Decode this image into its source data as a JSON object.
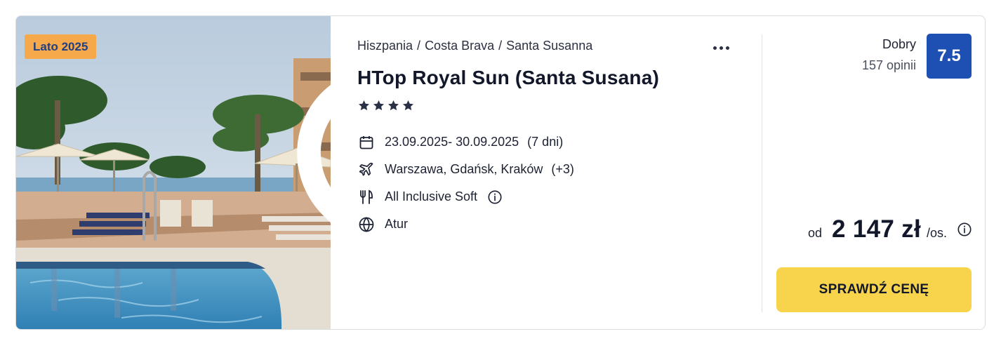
{
  "badge": {
    "label": "Lato 2025",
    "color": "#f6a94a"
  },
  "favorite": {
    "icon": "heart-icon"
  },
  "breadcrumb": [
    "Hiszpania",
    "Costa Brava",
    "Santa Susanna"
  ],
  "breadcrumb_separator": "/",
  "more_menu": {
    "icon": "more-dots-icon"
  },
  "hotel": {
    "name": "HTop Royal Sun (Santa Susana)",
    "stars": 4
  },
  "details": {
    "dates": "23.09.2025- 30.09.2025",
    "duration": "(7 dni)",
    "airports": "Warszawa, Gdańsk, Kraków",
    "airports_more": "(+3)",
    "board": "All Inclusive Soft",
    "operator": "Atur"
  },
  "rating": {
    "word": "Dobry",
    "count": "157 opinii",
    "score": "7.5",
    "score_color": "#1e4fb3"
  },
  "price": {
    "prefix": "od",
    "value": "2 147 zł",
    "suffix": "/os."
  },
  "cta": {
    "label": "SPRAWDŹ CENĘ",
    "color": "#f7d44c"
  }
}
